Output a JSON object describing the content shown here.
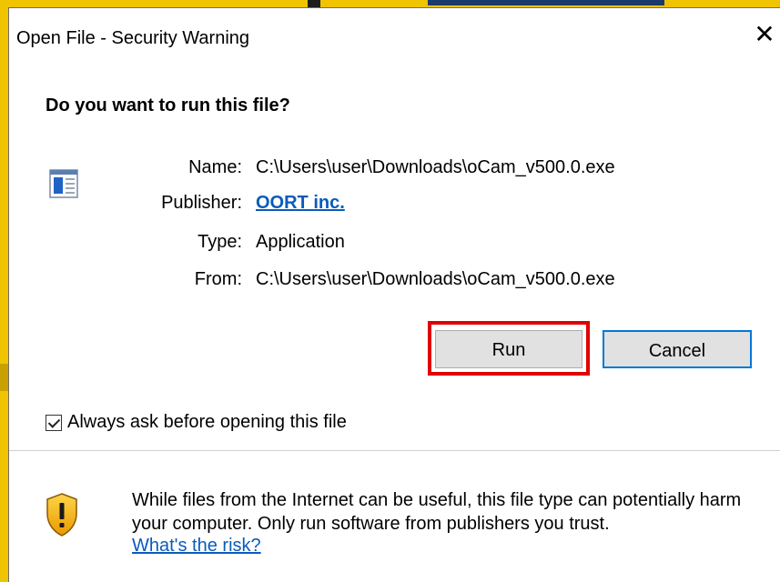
{
  "dialog": {
    "title": "Open File - Security Warning",
    "close_glyph": "✕",
    "heading": "Do you want to run this file?"
  },
  "file_info": {
    "icon": "application-window-icon",
    "rows": [
      {
        "label": "Name:",
        "value": "C:\\Users\\user\\Downloads\\oCam_v500.0.exe"
      },
      {
        "label": "Publisher:",
        "value": "OORT inc."
      },
      {
        "label": "Type:",
        "value": "Application"
      },
      {
        "label": "From:",
        "value": "C:\\Users\\user\\Downloads\\oCam_v500.0.exe"
      }
    ]
  },
  "buttons": {
    "run_label": "Run",
    "cancel_label": "Cancel"
  },
  "checkbox": {
    "label": "Always ask before opening this file",
    "checked": true
  },
  "warning": {
    "icon": "shield-warning-icon",
    "text": "While files from the Internet can be useful, this file type can potentially harm your computer. Only run software from publishers you trust.",
    "risk_link": "What's the risk?"
  },
  "colors": {
    "highlight": "#e00000",
    "link": "#0a5bbb",
    "focus_border": "#0078d7"
  }
}
